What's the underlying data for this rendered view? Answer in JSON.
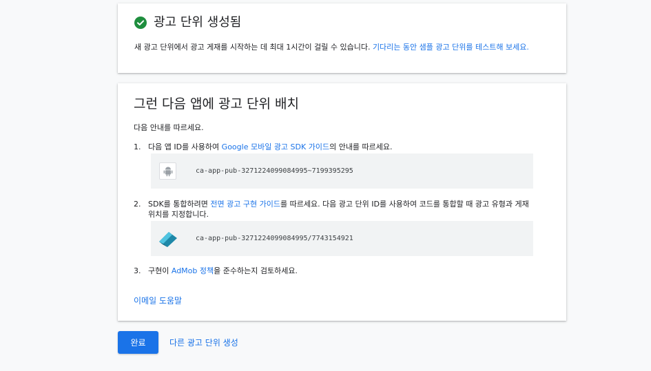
{
  "colors": {
    "accent": "#1a73e8",
    "success": "#1e8e3e",
    "background": "#f8f9fa"
  },
  "card1": {
    "title": "광고 단위 생성됨",
    "body": "새 광고 단위에서 광고 게재를 시작하는 데 최대 1시간이 걸릴 수 있습니다. ",
    "body_link": "기다리는 동안 샘플 광고 단위를 테스트해 보세요.",
    "icon": "check-circle-icon"
  },
  "card2": {
    "title": "그런 다음 앱에 광고 단위 배치",
    "intro": "다음 안내를 따르세요.",
    "step1": {
      "num": "1.",
      "pre": "다음 앱 ID를 사용하여 ",
      "link": "Google 모바일 광고 SDK 가이드",
      "post": "의 안내를 따르세요.",
      "app_id": "ca-app-pub-3271224099084995~7199395295",
      "icon": "android-icon"
    },
    "step2": {
      "num": "2.",
      "pre": "SDK를 통합하려면 ",
      "link": "전면 광고 구현 가이드",
      "post": "를 따르세요. 다음 광고 단위 ID를 사용하여 코드를 통합할 때 광고 유형과 게재위치를 지정합니다.",
      "ad_unit_id": "ca-app-pub-3271224099084995/7743154921",
      "icon": "interstitial-format-icon"
    },
    "step3": {
      "num": "3.",
      "pre": "구현이 ",
      "link": "AdMob 정책",
      "post": "을 준수하는지 검토하세요."
    },
    "email_link": "이메일 도움말"
  },
  "footer": {
    "done_label": "완료",
    "create_another_label": "다른 광고 단위 생성"
  }
}
